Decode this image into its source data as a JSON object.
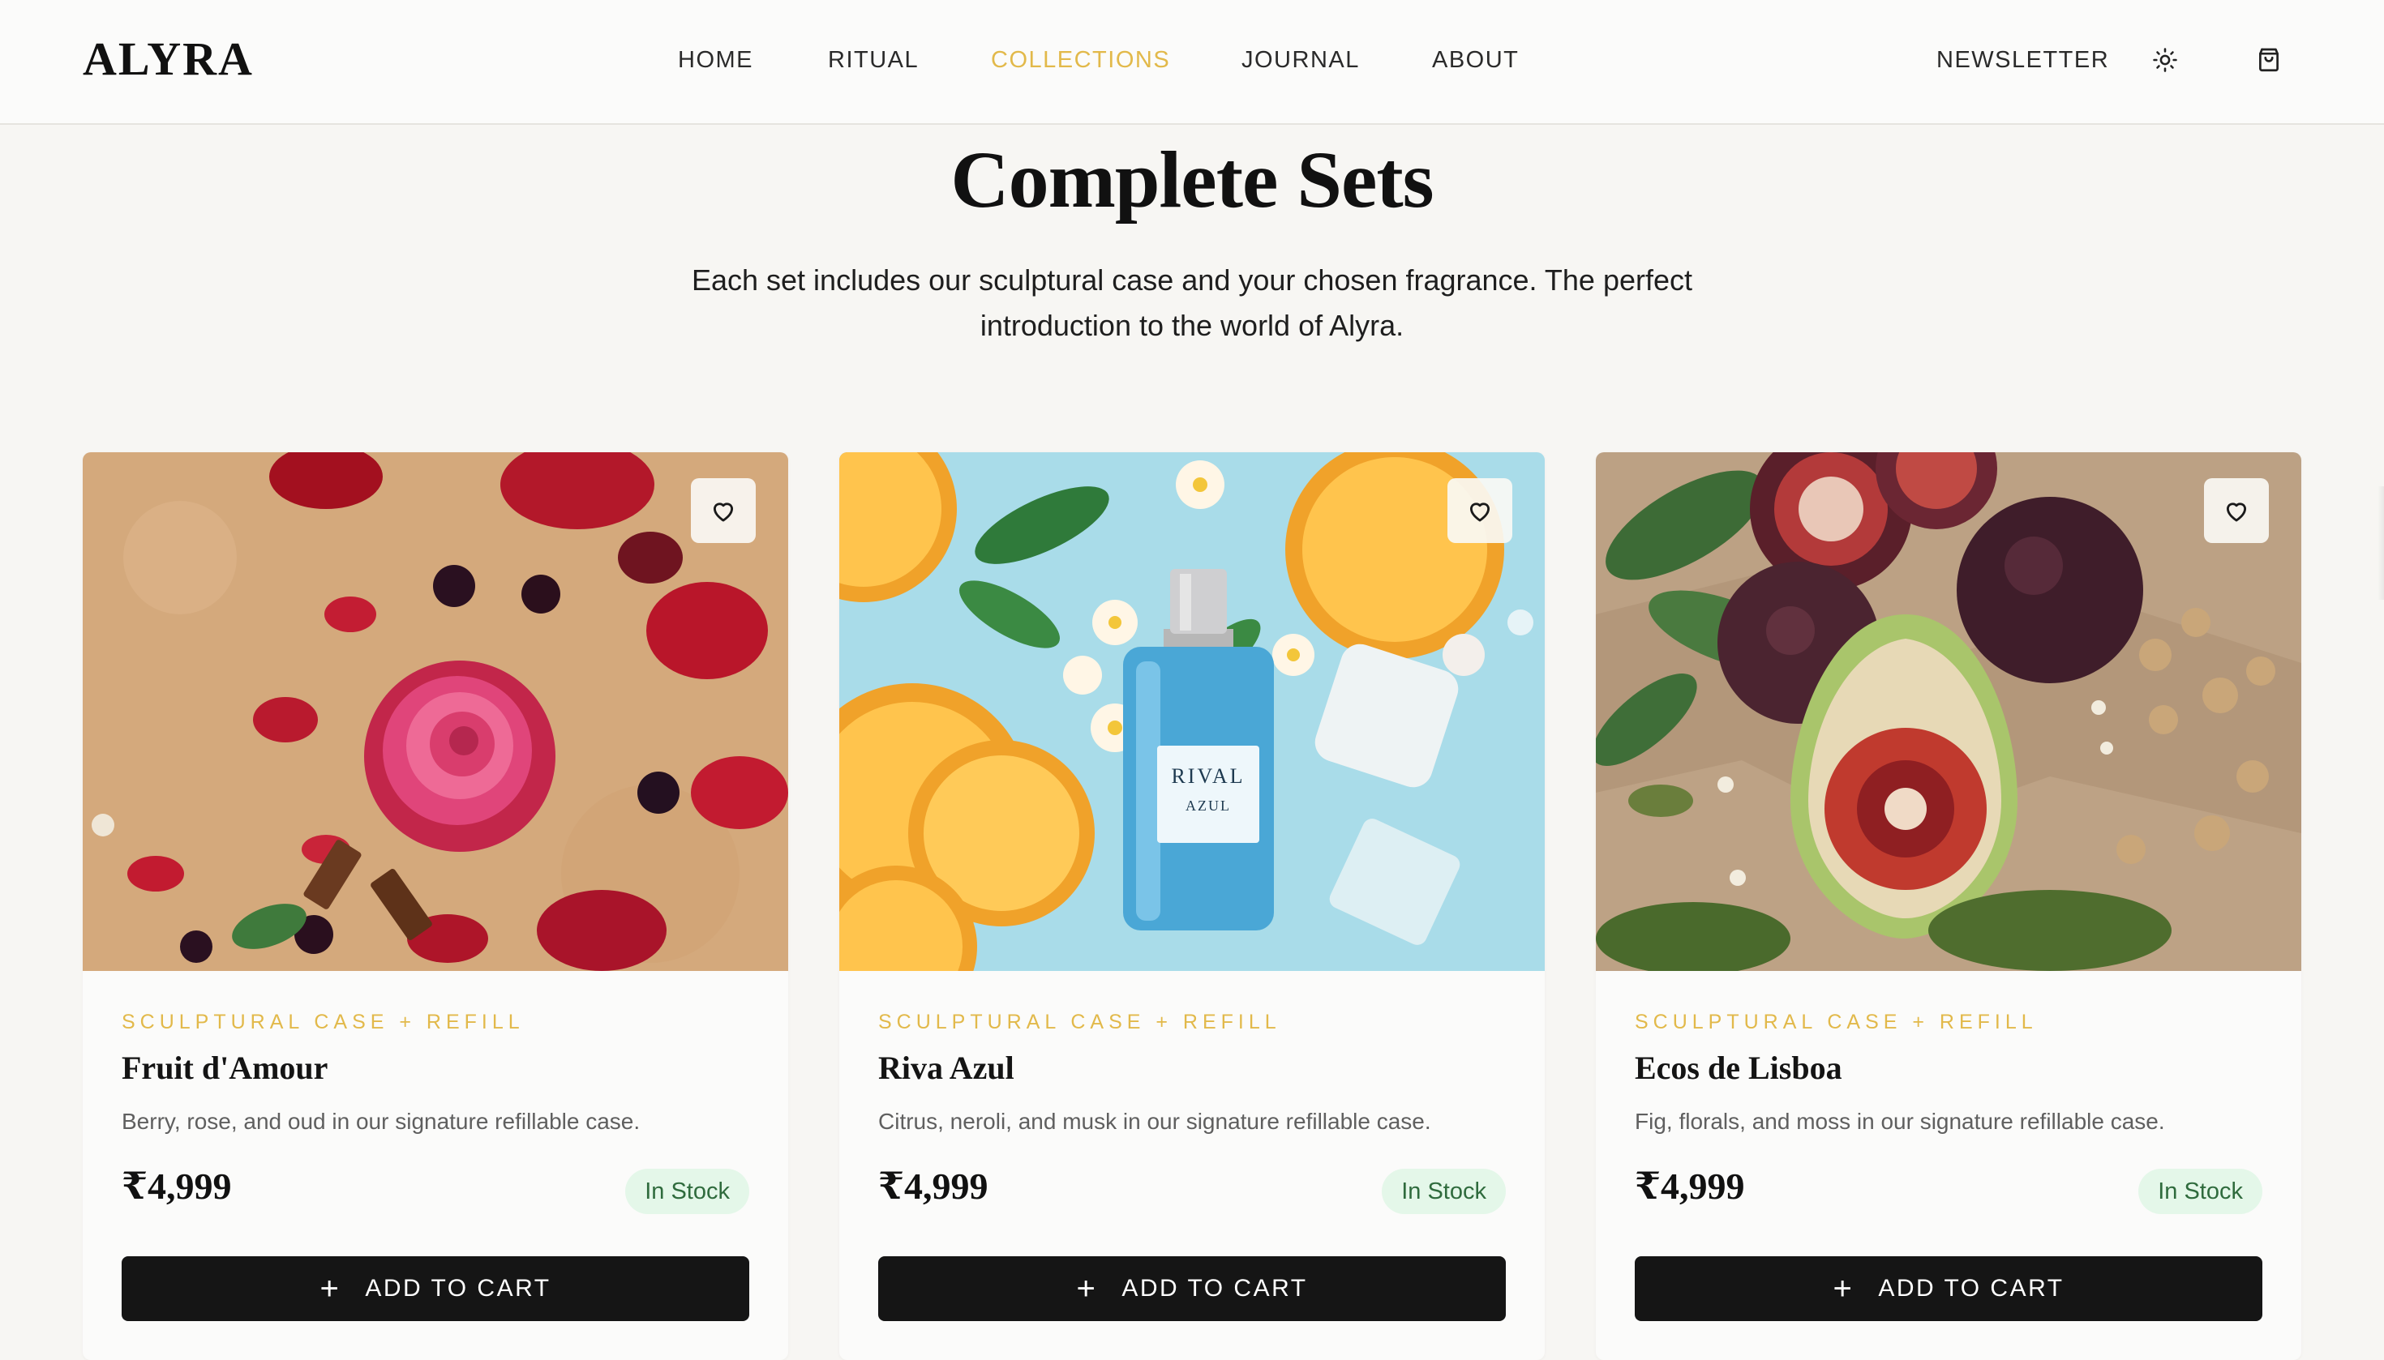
{
  "brand": {
    "logo": "ALYRA"
  },
  "nav": {
    "items": [
      {
        "label": "HOME",
        "active": false
      },
      {
        "label": "RITUAL",
        "active": false
      },
      {
        "label": "COLLECTIONS",
        "active": true
      },
      {
        "label": "JOURNAL",
        "active": false
      },
      {
        "label": "ABOUT",
        "active": false
      }
    ],
    "newsletter": "NEWSLETTER",
    "theme_icon": "sun-icon",
    "cart_icon": "shopping-bag-icon"
  },
  "page": {
    "title": "Complete Sets",
    "intro_line1": "Each set includes our sculptural case and your chosen fragrance. The perfect",
    "intro_line2": "introduction to the world of Alyra."
  },
  "products": [
    {
      "tag": "SCULPTURAL CASE + REFILL",
      "name": "Fruit d'Amour",
      "description": "Berry, rose, and oud in our signature refillable case.",
      "price": "₹4,999",
      "stock": "In Stock",
      "cta": "ADD TO CART",
      "image": "rose, blackberries and rose petals on kraft paper"
    },
    {
      "tag": "SCULPTURAL CASE + REFILL",
      "name": "Riva Azul",
      "description": "Citrus, neroli, and musk in our signature refillable case.",
      "price": "₹4,999",
      "stock": "In Stock",
      "cta": "ADD TO CART",
      "bottle_label_line1": "RIVAL",
      "bottle_label_line2": "AZUL",
      "image": "blue perfume bottle with orange slices and frangipani"
    },
    {
      "tag": "SCULPTURAL CASE + REFILL",
      "name": "Ecos de Lisboa",
      "description": "Fig, florals, and moss in our signature refillable case.",
      "price": "₹4,999",
      "stock": "In Stock",
      "cta": "ADD TO CART",
      "image": "figs, leaves, nuts and moss on crumpled paper"
    }
  ],
  "colors": {
    "accent": "#e2b94a",
    "background": "#f7f6f3",
    "button": "#151515",
    "stock_bg": "#e4f7e9",
    "stock_text": "#2f6b3d"
  }
}
